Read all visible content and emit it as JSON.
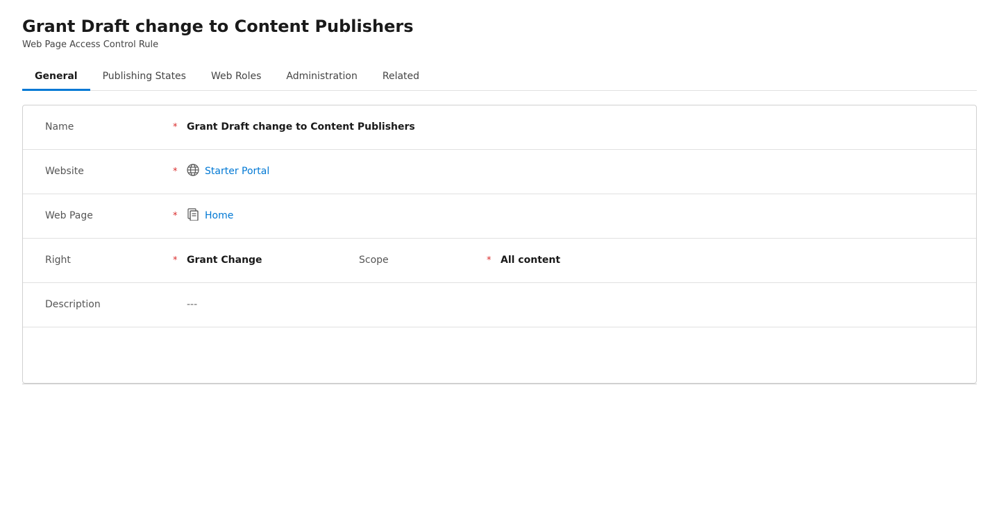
{
  "page": {
    "title": "Grant Draft change to Content Publishers",
    "subtitle": "Web Page Access Control Rule"
  },
  "tabs": [
    {
      "id": "general",
      "label": "General",
      "active": true
    },
    {
      "id": "publishing-states",
      "label": "Publishing States",
      "active": false
    },
    {
      "id": "web-roles",
      "label": "Web Roles",
      "active": false
    },
    {
      "id": "administration",
      "label": "Administration",
      "active": false
    },
    {
      "id": "related",
      "label": "Related",
      "active": false
    }
  ],
  "form": {
    "name": {
      "label": "Name",
      "required": true,
      "value": "Grant Draft change to Content Publishers"
    },
    "website": {
      "label": "Website",
      "required": true,
      "value": "Starter Portal"
    },
    "web_page": {
      "label": "Web Page",
      "required": true,
      "value": "Home"
    },
    "right": {
      "label": "Right",
      "required": true,
      "value": "Grant Change"
    },
    "scope": {
      "label": "Scope",
      "required": true,
      "value": "All content"
    },
    "description": {
      "label": "Description",
      "required": false,
      "value": "---"
    }
  },
  "icons": {
    "globe": "⊕",
    "page": "🗋",
    "required_star": "*"
  },
  "colors": {
    "accent": "#0078d4",
    "required": "#d92b2b",
    "tab_active_border": "#0078d4"
  }
}
